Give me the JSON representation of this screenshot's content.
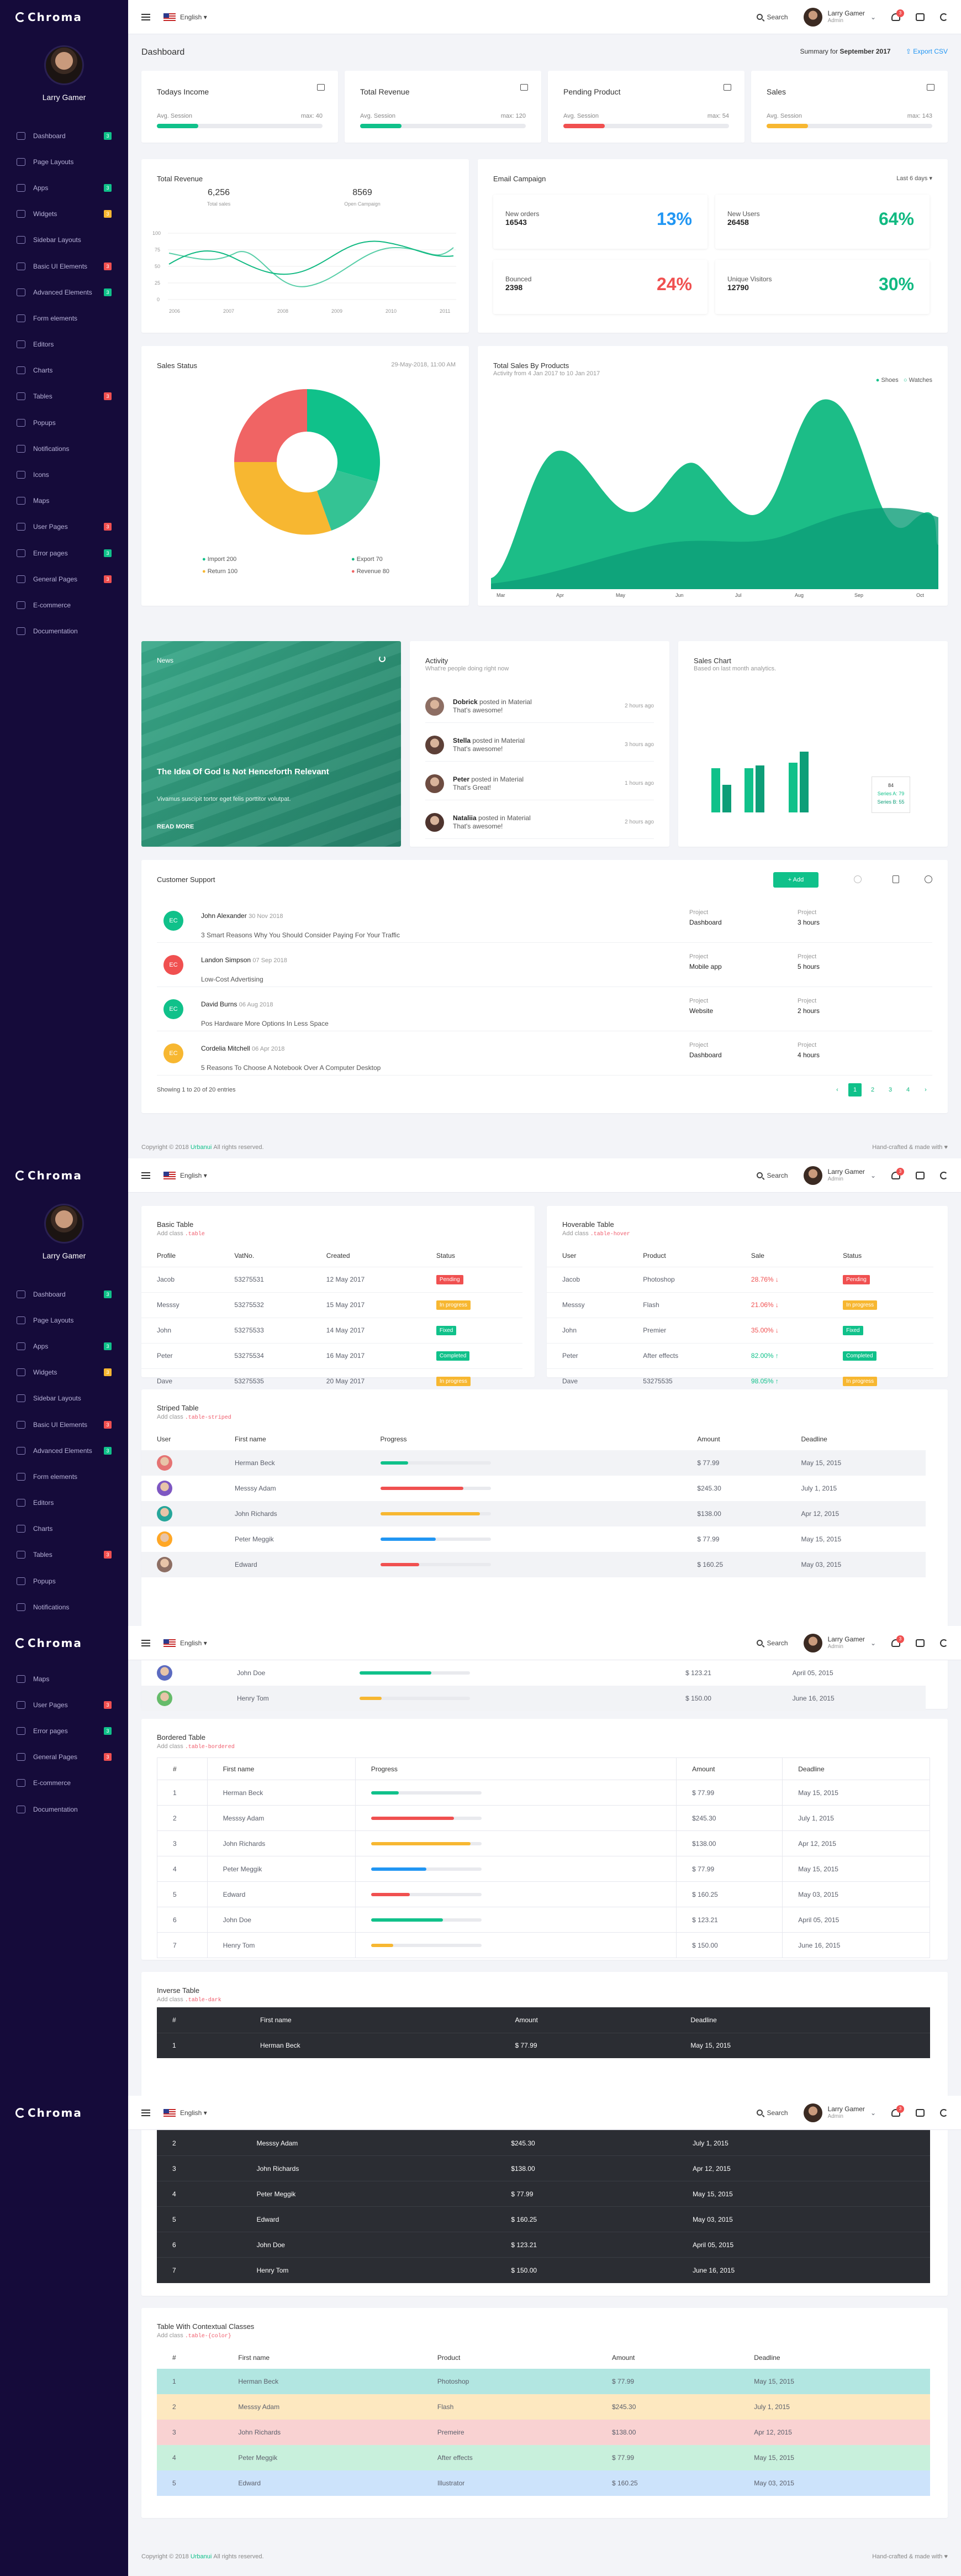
{
  "brand": "Chroma",
  "profile_name": "Larry Gamer",
  "language": "English",
  "search_label": "Search",
  "user": {
    "name": "Larry Gamer",
    "role": "Admin",
    "notif": "3"
  },
  "menu": [
    {
      "label": "Dashboard",
      "badge": "3",
      "color": "#10c18a"
    },
    {
      "label": "Page Layouts",
      "badge": "",
      "color": ""
    },
    {
      "label": "Apps",
      "badge": "3",
      "color": "#10c18a"
    },
    {
      "label": "Widgets",
      "badge": "3",
      "color": "#f7b731"
    },
    {
      "label": "Sidebar Layouts",
      "badge": "",
      "color": ""
    },
    {
      "label": "Basic UI Elements",
      "badge": "3",
      "color": "#f05050"
    },
    {
      "label": "Advanced Elements",
      "badge": "3",
      "color": "#10c18a"
    },
    {
      "label": "Form elements",
      "badge": "",
      "color": ""
    },
    {
      "label": "Editors",
      "badge": "",
      "color": ""
    },
    {
      "label": "Charts",
      "badge": "",
      "color": ""
    },
    {
      "label": "Tables",
      "badge": "3",
      "color": "#f05050"
    },
    {
      "label": "Popups",
      "badge": "",
      "color": ""
    },
    {
      "label": "Notifications",
      "badge": "",
      "color": ""
    },
    {
      "label": "Icons",
      "badge": "",
      "color": ""
    },
    {
      "label": "Maps",
      "badge": "",
      "color": ""
    },
    {
      "label": "User Pages",
      "badge": "3",
      "color": "#f05050"
    },
    {
      "label": "Error pages",
      "badge": "3",
      "color": "#10c18a"
    },
    {
      "label": "General Pages",
      "badge": "3",
      "color": "#f05050"
    },
    {
      "label": "E-commerce",
      "badge": "",
      "color": ""
    },
    {
      "label": "Documentation",
      "badge": "",
      "color": ""
    }
  ],
  "dash": {
    "title": "Dashboard",
    "summary_prefix": "Summary for",
    "summary_month": "September 2017",
    "export": "Export CSV",
    "stats": [
      {
        "label": "Todays Income",
        "sub": "Avg. Session",
        "max": "max: 40",
        "value": 0.25,
        "color": "#10c18a"
      },
      {
        "label": "Total Revenue",
        "sub": "Avg. Session",
        "max": "max: 120",
        "value": 0.25,
        "color": "#10c18a"
      },
      {
        "label": "Pending Product",
        "sub": "Avg. Session",
        "max": "max: 54",
        "value": 0.25,
        "color": "#f05050"
      },
      {
        "label": "Sales",
        "sub": "Avg. Session",
        "max": "max: 143",
        "value": 0.25,
        "color": "#f7b731"
      }
    ],
    "revenue": {
      "title": "Total Revenue",
      "v1": "6,256",
      "l1": "Total sales",
      "v2": "8569",
      "l2": "Open Campaign"
    },
    "email": {
      "title": "Email Campaign",
      "period": "Last 6 days",
      "boxes": [
        {
          "label": "New orders",
          "num": "16543",
          "pct": "13%",
          "color": "#2196f3"
        },
        {
          "label": "New Users",
          "num": "26458",
          "pct": "64%",
          "color": "#10b981"
        },
        {
          "label": "Bounced",
          "num": "2398",
          "pct": "24%",
          "color": "#f05050"
        },
        {
          "label": "Unique Visitors",
          "num": "12790",
          "pct": "30%",
          "color": "#10b981"
        }
      ]
    },
    "sales_status": {
      "title": "Sales Status",
      "date": "29-May-2018, 11:00 AM",
      "legend": [
        "Import 200",
        "Export 70",
        "Return 100",
        "Revenue 80"
      ]
    },
    "total_sales": {
      "title": "Total Sales By Products",
      "sub": "Activity from 4 Jan 2017 to 10 Jan 2017",
      "legend": [
        "Shoes",
        "Watches"
      ]
    },
    "news": {
      "label": "News",
      "headline": "The Idea Of God Is Not Henceforth Relevant",
      "body": "Vivamus suscipit tortor eget felis porttitor volutpat.",
      "more": "READ MORE"
    },
    "activity": {
      "title": "Activity",
      "sub": "What're people doing right now",
      "rows": [
        {
          "name": "Dobrick",
          "action": "posted in Material",
          "text": "That's awesome!",
          "time": "2 hours ago"
        },
        {
          "name": "Stella",
          "action": "posted in Material",
          "text": "That's awesome!",
          "time": "3 hours ago"
        },
        {
          "name": "Peter",
          "action": "posted in Material",
          "text": "That's Great!",
          "time": "1 hours ago"
        },
        {
          "name": "Nataliia",
          "action": "posted in Material",
          "text": "That's awesome!",
          "time": "2 hours ago"
        }
      ]
    },
    "sales_chart": {
      "title": "Sales Chart",
      "sub": "Based on last month analytics.",
      "tip_val": "84",
      "tip_a": "Series A: 79",
      "tip_b": "Series B: 55"
    },
    "support": {
      "title": "Customer Support",
      "add": "Add",
      "col_a": "Project",
      "col_b": "Project",
      "footer": "Showing 1 to 20 of 20 entries",
      "pages": [
        "‹",
        "1",
        "2",
        "3",
        "4",
        "›"
      ],
      "rows": [
        {
          "init": "EC",
          "color": "#10c18a",
          "name": "John Alexander",
          "date": "30 Nov 2018",
          "msg": "3 Smart Reasons Why You Should Consider Paying For Your Traffic",
          "project": "Dashboard",
          "time": "3 hours"
        },
        {
          "init": "EC",
          "color": "#f05050",
          "name": "Landon Simpson",
          "date": "07 Sep 2018",
          "msg": "Low-Cost Advertising",
          "project": "Mobile app",
          "time": "5 hours"
        },
        {
          "init": "EC",
          "color": "#10c18a",
          "name": "David Burns",
          "date": "06 Aug 2018",
          "msg": "Pos Hardware More Options In Less Space",
          "project": "Website",
          "time": "2 hours"
        },
        {
          "init": "EC",
          "color": "#f7b731",
          "name": "Cordelia Mitchell",
          "date": "06 Apr 2018",
          "msg": "5 Reasons To Choose A Notebook Over A Computer Desktop",
          "project": "Dashboard",
          "time": "4 hours"
        }
      ]
    }
  },
  "footer": {
    "copy": "Copyright © 2018",
    "link": "Urbanui",
    "rights": "All rights reserved.",
    "right": "Hand-crafted & made with ♥"
  },
  "tables": {
    "basic": {
      "title": "Basic Table",
      "add": "Add class",
      "cls": ".table",
      "head": [
        "Profile",
        "VatNo.",
        "Created",
        "Status"
      ],
      "rows": [
        [
          "Jacob",
          "53275531",
          "12 May 2017",
          "Pending",
          "#f05050"
        ],
        [
          "Messsy",
          "53275532",
          "15 May 2017",
          "In progress",
          "#f7b731"
        ],
        [
          "John",
          "53275533",
          "14 May 2017",
          "Fixed",
          "#10c18a"
        ],
        [
          "Peter",
          "53275534",
          "16 May 2017",
          "Completed",
          "#10c18a"
        ],
        [
          "Dave",
          "53275535",
          "20 May 2017",
          "In progress",
          "#f7b731"
        ]
      ]
    },
    "hover": {
      "title": "Hoverable Table",
      "add": "Add class",
      "cls": ".table-hover",
      "head": [
        "User",
        "Product",
        "Sale",
        "Status"
      ],
      "rows": [
        [
          "Jacob",
          "Photoshop",
          "28.76% ↓",
          "Pending",
          "#f05050",
          "#f05050"
        ],
        [
          "Messsy",
          "Flash",
          "21.06% ↓",
          "In progress",
          "#f05050",
          "#f7b731"
        ],
        [
          "John",
          "Premier",
          "35.00% ↓",
          "Fixed",
          "#f05050",
          "#10c18a"
        ],
        [
          "Peter",
          "After effects",
          "82.00% ↑",
          "Completed",
          "#10c18a",
          "#10c18a"
        ],
        [
          "Dave",
          "53275535",
          "98.05% ↑",
          "In progress",
          "#10c18a",
          "#f7b731"
        ]
      ]
    },
    "striped": {
      "title": "Striped Table",
      "add": "Add class",
      "cls": ".table-striped",
      "head": [
        "User",
        "First name",
        "Progress",
        "Amount",
        "Deadline"
      ],
      "rows": [
        [
          "Herman Beck",
          0.25,
          "#10c18a",
          "$ 77.99",
          "May 15, 2015"
        ],
        [
          "Messsy Adam",
          0.75,
          "#f05050",
          "$245.30",
          "July 1, 2015"
        ],
        [
          "John Richards",
          0.9,
          "#f7b731",
          "$138.00",
          "Apr 12, 2015"
        ],
        [
          "Peter Meggik",
          0.5,
          "#2196f3",
          "$ 77.99",
          "May 15, 2015"
        ],
        [
          "Edward",
          0.35,
          "#f05050",
          "$ 160.25",
          "May 03, 2015"
        ],
        [
          "John Doe",
          0.65,
          "#10c18a",
          "$ 123.21",
          "April 05, 2015"
        ],
        [
          "Henry Tom",
          0.2,
          "#f7b731",
          "$ 150.00",
          "June 16, 2015"
        ]
      ]
    },
    "bordered": {
      "title": "Bordered Table",
      "add": "Add class",
      "cls": ".table-bordered",
      "head": [
        "#",
        "First name",
        "Progress",
        "Amount",
        "Deadline"
      ],
      "rows": [
        [
          "1",
          "Herman Beck",
          0.25,
          "#10c18a",
          "$ 77.99",
          "May 15, 2015"
        ],
        [
          "2",
          "Messsy Adam",
          0.75,
          "#f05050",
          "$245.30",
          "July 1, 2015"
        ],
        [
          "3",
          "John Richards",
          0.9,
          "#f7b731",
          "$138.00",
          "Apr 12, 2015"
        ],
        [
          "4",
          "Peter Meggik",
          0.5,
          "#2196f3",
          "$ 77.99",
          "May 15, 2015"
        ],
        [
          "5",
          "Edward",
          0.35,
          "#f05050",
          "$ 160.25",
          "May 03, 2015"
        ],
        [
          "6",
          "John Doe",
          0.65,
          "#10c18a",
          "$ 123.21",
          "April 05, 2015"
        ],
        [
          "7",
          "Henry Tom",
          0.2,
          "#f7b731",
          "$ 150.00",
          "June 16, 2015"
        ]
      ]
    },
    "inverse": {
      "title": "Inverse Table",
      "add": "Add class",
      "cls": ".table-dark",
      "head": [
        "#",
        "First name",
        "Amount",
        "Deadline"
      ],
      "rows": [
        [
          "1",
          "Herman Beck",
          "$ 77.99",
          "May 15, 2015"
        ],
        [
          "2",
          "Messsy Adam",
          "$245.30",
          "July 1, 2015"
        ],
        [
          "3",
          "John Richards",
          "$138.00",
          "Apr 12, 2015"
        ],
        [
          "4",
          "Peter Meggik",
          "$ 77.99",
          "May 15, 2015"
        ],
        [
          "5",
          "Edward",
          "$ 160.25",
          "May 03, 2015"
        ],
        [
          "6",
          "John Doe",
          "$ 123.21",
          "April 05, 2015"
        ],
        [
          "7",
          "Henry Tom",
          "$ 150.00",
          "June 16, 2015"
        ]
      ]
    },
    "contextual": {
      "title": "Table With Contextual Classes",
      "add": "Add class",
      "cls": ".table-{color}",
      "head": [
        "#",
        "First name",
        "Product",
        "Amount",
        "Deadline"
      ],
      "rows": [
        [
          "1",
          "Herman Beck",
          "Photoshop",
          "$ 77.99",
          "May 15, 2015",
          "#b2e6e1"
        ],
        [
          "2",
          "Messsy Adam",
          "Flash",
          "$245.30",
          "July 1, 2015",
          "#fde8c0"
        ],
        [
          "3",
          "John Richards",
          "Premeire",
          "$138.00",
          "Apr 12, 2015",
          "#f9d2d2"
        ],
        [
          "4",
          "Peter Meggik",
          "After effects",
          "$ 77.99",
          "May 15, 2015",
          "#c8f0dc"
        ],
        [
          "5",
          "Edward",
          "Illustrator",
          "$ 160.25",
          "May 03, 2015",
          "#cce3fb"
        ]
      ]
    }
  }
}
